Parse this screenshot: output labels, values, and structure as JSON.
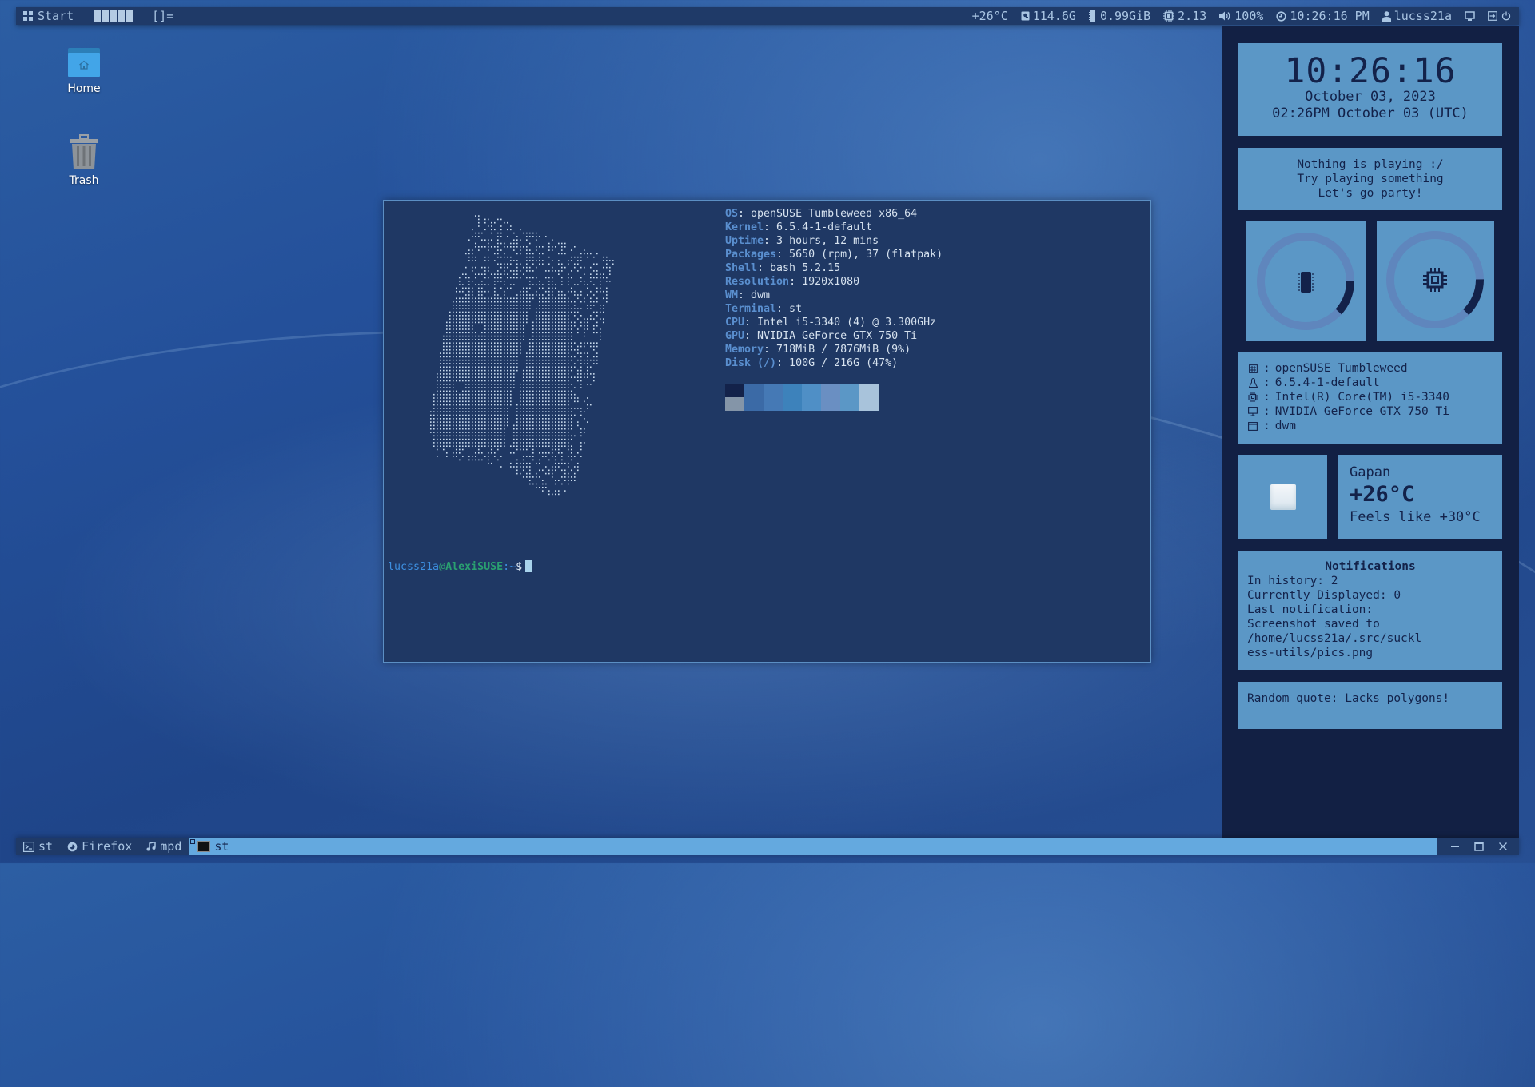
{
  "topbar": {
    "start_label": "Start",
    "tag_count": 5,
    "layout_symbol": "[]=",
    "stats": {
      "temperature": "+26°C",
      "disk": "114.6G",
      "memory": "0.99GiB",
      "cpu_load": "2.13",
      "volume": "100%",
      "clock": "10:26:16 PM",
      "user": "lucss21a"
    },
    "icons": [
      "temp",
      "disk-icon",
      "memory-icon",
      "cpu-icon",
      "volume-icon",
      "clock-icon",
      "user-icon",
      "display-icon",
      "logout-icon",
      "power-icon"
    ]
  },
  "desktop": {
    "icons": [
      {
        "label": "Home",
        "icon": "home-folder-icon"
      },
      {
        "label": "Trash",
        "icon": "trash-icon"
      }
    ]
  },
  "terminal": {
    "fetch": [
      {
        "key": "OS",
        "value": "openSUSE Tumbleweed x86_64"
      },
      {
        "key": "Kernel",
        "value": "6.5.4-1-default"
      },
      {
        "key": "Uptime",
        "value": "3 hours, 12 mins"
      },
      {
        "key": "Packages",
        "value": "5650 (rpm), 37 (flatpak)"
      },
      {
        "key": "Shell",
        "value": "bash 5.2.15"
      },
      {
        "key": "Resolution",
        "value": "1920x1080"
      },
      {
        "key": "WM",
        "value": "dwm"
      },
      {
        "key": "Terminal",
        "value": "st"
      },
      {
        "key": "CPU",
        "value": "Intel i5-3340 (4) @ 3.300GHz"
      },
      {
        "key": "GPU",
        "value": "NVIDIA GeForce GTX 750 Ti"
      },
      {
        "key": "Memory",
        "value": "718MiB / 7876MiB (9%)"
      },
      {
        "key": "Disk (/)",
        "value": "100G / 216G (47%)"
      }
    ],
    "palette_top": [
      "#13224a",
      "#3b6aa6",
      "#4579b5",
      "#3d82bb",
      "#4f8fc6",
      "#6a8fc2",
      "#5b97c6",
      "#a8c3db"
    ],
    "palette_bottom": [
      "#8495a8",
      "#3b6aa6",
      "#4579b5",
      "#3d82bb",
      "#4f8fc6",
      "#6a8fc2",
      "#5b97c6",
      "#a8c3db"
    ],
    "prompt": {
      "user": "lucss21a",
      "at": "@",
      "host": "AlexiSUSE",
      "path": ":~",
      "symbol": "$"
    }
  },
  "panel": {
    "clock": {
      "time": "10:26:16",
      "date": "October 03, 2023",
      "utc": "02:26PM October 03 (UTC)"
    },
    "music": {
      "lines": [
        "Nothing is playing :/",
        "Try playing something",
        "Let's go party!"
      ]
    },
    "gauges": [
      {
        "name": "memory",
        "icon": "memory-chip-icon",
        "fraction": 0.12
      },
      {
        "name": "cpu",
        "icon": "cpu-icon",
        "fraction": 0.13
      }
    ],
    "sysinfo": [
      {
        "icon": "distro-icon",
        "value": "openSUSE Tumbleweed"
      },
      {
        "icon": "linux-tux-icon",
        "value": "6.5.4-1-default"
      },
      {
        "icon": "cpu-icon",
        "value": "Intel(R) Core(TM) i5-3340"
      },
      {
        "icon": "monitor-icon",
        "value": "NVIDIA GeForce GTX 750 Ti"
      },
      {
        "icon": "window-icon",
        "value": "dwm"
      }
    ],
    "sysinfo_separator": ":",
    "weather": {
      "icon": "cloudy-icon",
      "city": "Gapan",
      "temp": "+26°C",
      "feels": "Feels like +30°C"
    },
    "notifications": {
      "title": "Notifications",
      "lines": [
        "In history: 2",
        "Currently Displayed: 0",
        "Last notification:",
        "Screenshot saved to",
        "/home/lucss21a/.src/suckl",
        "ess-utils/pics.png"
      ]
    },
    "quote": "Random quote: Lacks polygons!"
  },
  "taskbar": {
    "tasks": [
      {
        "label": "st",
        "icon": "terminal-icon",
        "active": false
      },
      {
        "label": "Firefox",
        "icon": "firefox-icon",
        "active": false
      },
      {
        "label": "mpd",
        "icon": "music-note-icon",
        "active": false
      },
      {
        "label": "st",
        "icon": "terminal-app-icon",
        "active": true
      }
    ],
    "controls": [
      "minimize",
      "maximize",
      "close"
    ]
  },
  "colors": {
    "bar_bg": "#1f3a68",
    "bar_fg": "#a9c5e3",
    "panel_bg": "#122044",
    "card_bg": "#5b97c6",
    "card_fg": "#13224a",
    "terminal_bg": "#1f3864",
    "active_task": "#64a9df"
  }
}
